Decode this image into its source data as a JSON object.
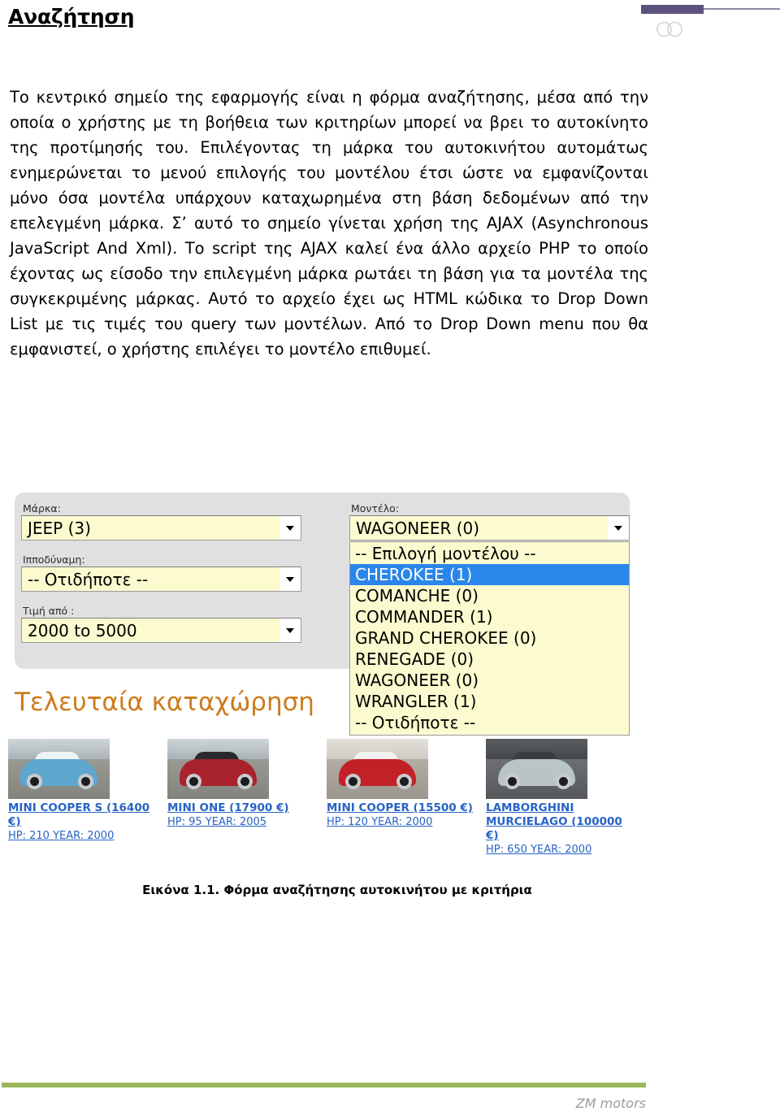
{
  "header": {
    "title": "Αναζήτηση",
    "logo_icon": "infinity-logo-icon",
    "accent_purple": "#5d527f"
  },
  "body": {
    "paragraph": "Το κεντρικό σημείο της εφαρμογής είναι η φόρμα αναζήτησης, μέσα από την οποία ο χρήστης με τη βοήθεια των κριτηρίων μπορεί να βρει το αυτοκίνητο της προτίμησής του. Επιλέγοντας τη μάρκα του αυτοκινήτου αυτομάτως ενημερώνεται το μενού επιλογής του μοντέλου έτσι ώστε να εμφανίζονται μόνο όσα μοντέλα υπάρχουν καταχωρημένα στη βάση δεδομένων από την επελεγμένη μάρκα. Σ’ αυτό το σημείο γίνεται χρήση της AJAX (Asynchronous JavaScript And Xml). Το script της AJAX καλεί ένα άλλο αρχείο PHP  το οποίο έχοντας ως είσοδο την επιλεγμένη μάρκα ρωτάει τη βάση για τα μοντέλα της συγκεκριμένης μάρκας. Αυτό το αρχείο έχει ως HTML κώδικα το Drop Down List με τις τιμές του query των μοντέλων. Από το Drop Down menu που θα εμφανιστεί, ο χρήστης επιλέγει το μοντέλο επιθυμεί."
  },
  "figure": {
    "caption": "Εικόνα 1.1. Φόρμα αναζήτησης αυτοκινήτου με κριτήρια",
    "search_form": {
      "fields_left": [
        {
          "label": "Μάρκα:",
          "value": "JEEP (3)"
        },
        {
          "label": "Ιπποδύναμη:",
          "value": "-- Οτιδήποτε --"
        },
        {
          "label": "Τιμή από :",
          "value": "2000 to 5000"
        }
      ],
      "field_model": {
        "label": "Μοντέλο:",
        "value": "WAGONEER (0)"
      },
      "model_options": [
        {
          "label": "-- Επιλογή μοντέλου --",
          "selected": false
        },
        {
          "label": "CHEROKEE (1)",
          "selected": true
        },
        {
          "label": "COMANCHE (0)",
          "selected": false
        },
        {
          "label": "COMMANDER (1)",
          "selected": false
        },
        {
          "label": "GRAND CHEROKEE (0)",
          "selected": false
        },
        {
          "label": "RENEGADE (0)",
          "selected": false
        },
        {
          "label": "WAGONEER (0)",
          "selected": false
        },
        {
          "label": "WRANGLER (1)",
          "selected": false
        },
        {
          "label": "-- Οτιδήποτε --",
          "selected": false
        }
      ],
      "highlight_color": "#2a86ea",
      "field_bg_color": "#fbfbcf",
      "panel_bg_color": "#e0e0e0"
    },
    "latest_heading": "Τελευταία καταχώρηση",
    "latest_heading_color": "#cd7b1b",
    "cars": [
      {
        "title": "MINI COOPER S (16400 €)",
        "specs": "HP: 210  YEAR: 2000",
        "body_color": "#5fa7cf",
        "roof_color": "#eef3f5"
      },
      {
        "title": "MINI ONE (17900 €)",
        "specs": "HP: 95 YEAR: 2005",
        "body_color": "#a8232c",
        "roof_color": "#2a2a2e"
      },
      {
        "title": "MINI COOPER (15500 €)",
        "specs": "HP: 120  YEAR: 2000",
        "body_color": "#c32027",
        "roof_color": "#f2f2f0"
      },
      {
        "title": "LAMBORGHINI MURCIELAGO (100000 €)",
        "specs": "HP: 650  YEAR: 2000",
        "body_color": "#b9c4c6",
        "roof_color": "#3a3d40"
      }
    ]
  },
  "footer": {
    "text": "ZM motors",
    "rule_color": "#9bb75a"
  }
}
